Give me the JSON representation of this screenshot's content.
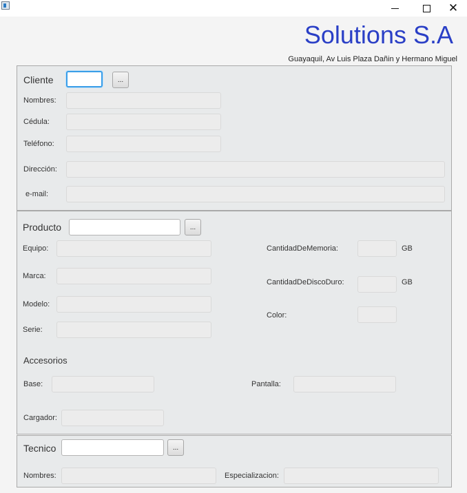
{
  "window": {
    "icon": "app-window-icon",
    "minimize_icon": "minimize-icon",
    "maximize_icon": "maximize-icon",
    "close_glyph": "✕"
  },
  "header": {
    "company": "Solutions S.A",
    "address": "Guayaquil, Av Luis Plaza Dañin y Hermano Miguel",
    "company_color": "#2a3fc6"
  },
  "cliente": {
    "title": "Cliente",
    "code_value": "",
    "browse_label": "...",
    "nombres_label": "Nombres:",
    "cedula_label": "Cédula:",
    "telefono_label": "Teléfono:",
    "direccion_label": "Dirección:",
    "email_label": "e-mail:"
  },
  "producto": {
    "title": "Producto",
    "code_value": "",
    "browse_label": "...",
    "equipo_label": "Equipo:",
    "marca_label": "Marca:",
    "modelo_label": "Modelo:",
    "serie_label": "Serie:",
    "memoria_label": "CantidadDeMemoria:",
    "disco_label": "CantidadDeDiscoDuro:",
    "color_label": "Color:",
    "gb_unit": "GB",
    "accesorios_title": "Accesorios",
    "base_label": "Base:",
    "pantalla_label": "Pantalla:",
    "cargador_label": "Cargador:"
  },
  "tecnico": {
    "title": "Tecnico",
    "code_value": "",
    "browse_label": "...",
    "nombres_label": "Nombres:",
    "especializacion_label": "Especializacion:"
  }
}
